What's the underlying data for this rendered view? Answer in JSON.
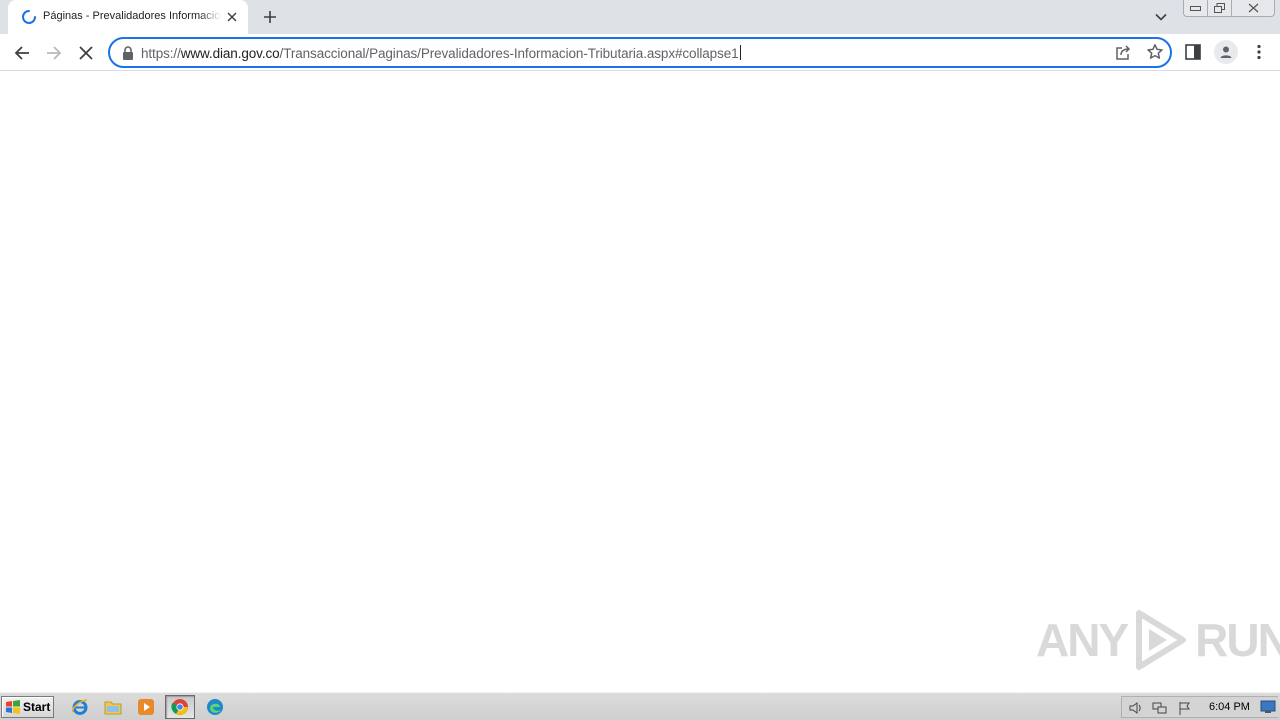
{
  "browser": {
    "tab": {
      "title": "Páginas - Prevalidadores Informacion Tributaria",
      "loading": true
    },
    "address_bar": {
      "url_scheme": "https://",
      "url_host": "www.dian.gov.co",
      "url_path": "/Transaccional/Paginas/Prevalidadores-Informacion-Tributaria.aspx#collapse1"
    },
    "icons": {
      "back": "back-arrow-icon",
      "forward": "forward-arrow-icon",
      "stop": "stop-loading-icon",
      "lock": "lock-icon",
      "share": "share-icon",
      "bookmark": "star-icon",
      "side_panel": "side-panel-icon",
      "profile": "profile-icon",
      "menu": "kebab-menu-icon"
    },
    "accent_color": "#1a73e8"
  },
  "watermark": {
    "left": "ANY",
    "right": "RUN"
  },
  "taskbar": {
    "start_label": "Start",
    "pinned": [
      "internet-explorer-icon",
      "file-explorer-icon",
      "media-player-icon",
      "chrome-icon",
      "edge-icon"
    ],
    "active": "chrome-icon",
    "clock": "6:04 PM"
  }
}
